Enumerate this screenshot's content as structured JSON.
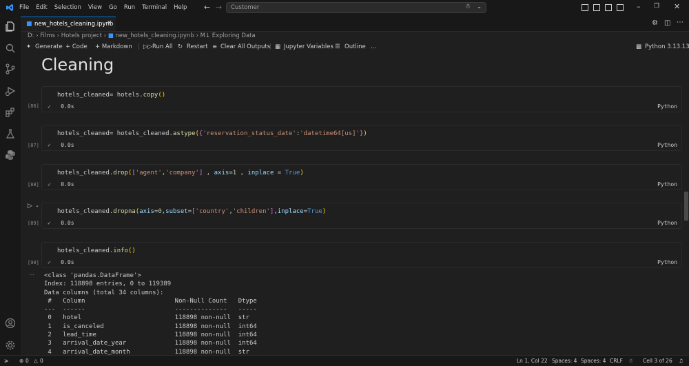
{
  "menu": [
    "File",
    "Edit",
    "Selection",
    "View",
    "Go",
    "Run",
    "Terminal",
    "Help"
  ],
  "search": {
    "text": "Customer"
  },
  "tab": {
    "label": "new_hotels_cleaning.ipynb"
  },
  "breadcrumb": [
    "D:",
    "Films",
    "Hotels project",
    "new_hotels_cleaning.ipynb",
    "M↓ Exploring Data"
  ],
  "toolbar": {
    "generate": "Generate",
    "code": "+ Code",
    "markdown": "+ Markdown",
    "run_all": "Run All",
    "restart": "Restart",
    "clear": "Clear All Outputs",
    "variables": "Jupyter Variables",
    "outline": "Outline",
    "more": "…",
    "kernel": "Python 3.13.13"
  },
  "heading": "Cleaning",
  "cells": [
    {
      "exec": "[86]",
      "status": "0.0s",
      "lang": "Python"
    },
    {
      "exec": "[87]",
      "status": "0.0s",
      "lang": "Python"
    },
    {
      "exec": "[88]",
      "status": "0.0s",
      "lang": "Python"
    },
    {
      "exec": "[89]",
      "status": "0.0s",
      "lang": "Python"
    },
    {
      "exec": "[90]",
      "status": "0.0s",
      "lang": "Python"
    }
  ],
  "code": {
    "c1": {
      "a": "hotels_cleaned= hotels.",
      "b": "copy",
      "c": "()"
    },
    "c2": {
      "a": "hotels_cleaned= hotels_cleaned.",
      "b": "astype",
      "c": "(",
      "d": "{",
      "e": "'reservation_status_date'",
      "f": ":",
      "g": "'datetime64[us]'",
      "h": "}",
      ")": ")"
    },
    "c3": {
      "a": "hotels_cleaned.",
      "b": "drop",
      "c": "(",
      "d": "[",
      "e": "'agent'",
      "f": ",",
      "g": "'company'",
      "h": "]",
      "i": " , ",
      "j": "axis",
      "k": "=",
      "l": "1",
      "m": " , ",
      "n": "inplace",
      "o": " = ",
      "p": "True",
      ")": ")"
    },
    "c4": {
      "a": "hotels_cleaned.",
      "b": "dropna",
      "c": "(",
      "j": "axis",
      "k": "=",
      "l": "0",
      "m": ",",
      "n": "subset",
      "o": "=",
      "d": "[",
      "e": "'country'",
      "f": ",",
      "g": "'children'",
      "h": "]",
      "q": ",",
      "r": "inplace",
      "s": "=",
      "p": "True",
      ")": ")"
    },
    "c5": {
      "a": "hotels_cleaned.",
      "b": "info",
      "c": "()"
    }
  },
  "output": [
    "<class 'pandas.DataFrame'>",
    "Index: 118898 entries, 0 to 119389",
    "Data columns (total 34 columns):",
    " #   Column                        Non-Null Count   Dtype",
    "---  ------                        --------------   -----",
    " 0   hotel                         118898 non-null  str",
    " 1   is_canceled                   118898 non-null  int64",
    " 2   lead_time                     118898 non-null  int64",
    " 3   arrival_date_year             118898 non-null  int64",
    " 4   arrival_date_month            118898 non-null  str"
  ],
  "status": {
    "errors": "0",
    "warnings": "0",
    "position": "Ln 1, Col 22",
    "spaces1": "Spaces: 4",
    "spaces2": "Spaces: 4",
    "eol": "CRLF",
    "cell": "Cell 3 of 26"
  },
  "colors": {
    "accent": "#0078d4",
    "background": "#1f1f1f"
  }
}
